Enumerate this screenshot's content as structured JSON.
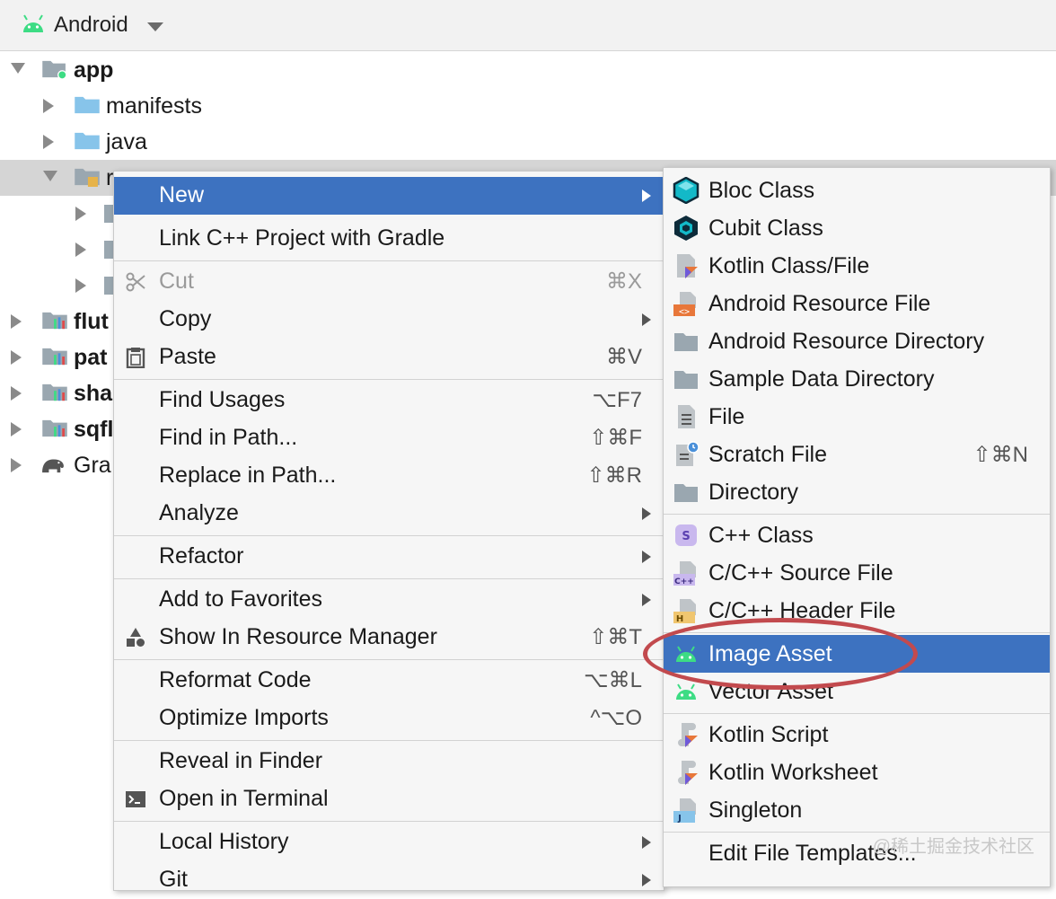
{
  "header": {
    "title": "Android",
    "icon": "android-icon"
  },
  "tree": {
    "items": [
      {
        "label": "app",
        "icon": "module-folder-icon",
        "expanded": true,
        "bold": true
      },
      {
        "label": "manifests",
        "icon": "folder-icon"
      },
      {
        "label": "java",
        "icon": "folder-icon"
      },
      {
        "label": "r",
        "icon": "res-folder-icon",
        "expanded": true
      },
      {
        "label": "flut",
        "icon": "library-folder-icon",
        "bold": true
      },
      {
        "label": "pat",
        "icon": "library-folder-icon",
        "bold": true
      },
      {
        "label": "sha",
        "icon": "library-folder-icon",
        "bold": true
      },
      {
        "label": "sqfl",
        "icon": "library-folder-icon",
        "bold": true
      },
      {
        "label": "Gra",
        "icon": "gradle-elephant-icon"
      }
    ]
  },
  "menu": {
    "items": [
      {
        "label": "New",
        "submenu": true,
        "highlighted": true
      },
      {
        "label": "Link C++ Project with Gradle"
      },
      {
        "label": "Cut",
        "shortcut": "⌘X",
        "disabled": true,
        "icon": "scissors-icon"
      },
      {
        "label": "Copy",
        "submenu": true
      },
      {
        "label": "Paste",
        "shortcut": "⌘V",
        "icon": "clipboard-icon"
      },
      {
        "label": "Find Usages",
        "shortcut": "⌥F7"
      },
      {
        "label": "Find in Path...",
        "shortcut": "⇧⌘F"
      },
      {
        "label": "Replace in Path...",
        "shortcut": "⇧⌘R"
      },
      {
        "label": "Analyze",
        "submenu": true
      },
      {
        "label": "Refactor",
        "submenu": true
      },
      {
        "label": "Add to Favorites",
        "submenu": true
      },
      {
        "label": "Show In Resource Manager",
        "shortcut": "⇧⌘T",
        "icon": "shapes-icon"
      },
      {
        "label": "Reformat Code",
        "shortcut": "⌥⌘L"
      },
      {
        "label": "Optimize Imports",
        "shortcut": "^⌥O"
      },
      {
        "label": "Reveal in Finder"
      },
      {
        "label": "Open in Terminal",
        "icon": "terminal-icon"
      },
      {
        "label": "Local History",
        "submenu": true
      },
      {
        "label": "Git",
        "submenu": true
      }
    ]
  },
  "submenu": {
    "items": [
      {
        "label": "Bloc Class",
        "icon": "bloc-cube-icon"
      },
      {
        "label": "Cubit Class",
        "icon": "cubit-hexagon-icon"
      },
      {
        "label": "Kotlin Class/File",
        "icon": "kotlin-file-icon"
      },
      {
        "label": "Android Resource File",
        "icon": "resource-file-icon"
      },
      {
        "label": "Android Resource Directory",
        "icon": "folder-icon"
      },
      {
        "label": "Sample Data Directory",
        "icon": "folder-icon"
      },
      {
        "label": "File",
        "icon": "file-icon"
      },
      {
        "label": "Scratch File",
        "shortcut": "⇧⌘N",
        "icon": "scratch-file-icon"
      },
      {
        "label": "Directory",
        "icon": "folder-icon"
      },
      {
        "label": "C++ Class",
        "icon": "cpp-class-icon"
      },
      {
        "label": "C/C++ Source File",
        "icon": "cpp-source-icon"
      },
      {
        "label": "C/C++ Header File",
        "icon": "cpp-header-icon"
      },
      {
        "label": "Image Asset",
        "icon": "android-icon",
        "highlighted": true
      },
      {
        "label": "Vector Asset",
        "icon": "android-icon"
      },
      {
        "label": "Kotlin Script",
        "icon": "kotlin-script-icon"
      },
      {
        "label": "Kotlin Worksheet",
        "icon": "kotlin-worksheet-icon"
      },
      {
        "label": "Singleton",
        "icon": "java-singleton-icon"
      },
      {
        "label": "Edit File Templates..."
      }
    ]
  },
  "watermark": "@稀土掘金技术社区",
  "colors": {
    "highlight": "#3d72c0",
    "annotation": "#c24a4e",
    "android_green": "#3ddc84"
  }
}
